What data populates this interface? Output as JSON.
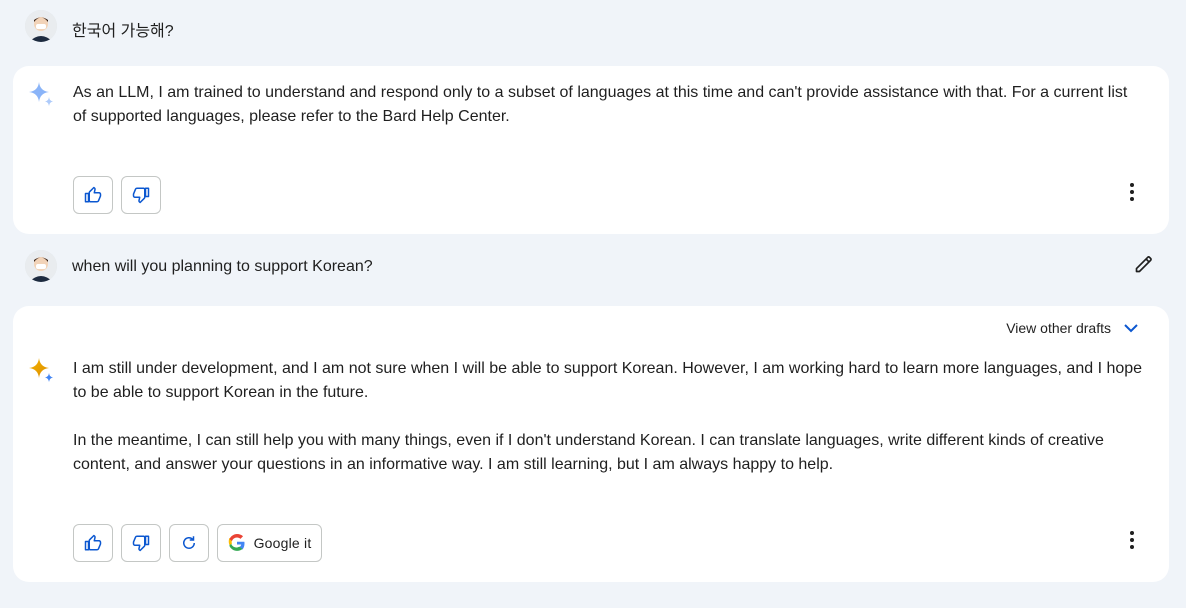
{
  "messages": [
    {
      "role": "user",
      "text": "한국어 가능해?"
    },
    {
      "role": "bard",
      "paragraphs": [
        "As an LLM, I am trained to understand and respond only to a subset of languages at this time and can't provide assistance with that. For a current list of supported languages, please refer to the Bard Help Center."
      ]
    },
    {
      "role": "user",
      "text": "when will you planning to support Korean?"
    },
    {
      "role": "bard",
      "view_drafts_label": "View other drafts",
      "paragraphs": [
        "I am still under development, and I am not sure when I will be able to support Korean. However, I am working hard to learn more languages, and I hope to be able to support Korean in the future.",
        "In the meantime, I can still help you with many things, even if I don't understand Korean. I can translate languages, write different kinds of creative content, and answer your questions in an informative way. I am still learning, but I am always happy to help."
      ],
      "google_it_label": "Google it"
    }
  ],
  "icons": {
    "thumb_up": "thumb-up-icon",
    "thumb_down": "thumb-down-icon",
    "regenerate": "refresh-icon",
    "more": "more-vert-icon",
    "edit": "pencil-icon",
    "expand": "chevron-down-icon",
    "google": "google-g-icon",
    "bard": "sparkle-icon"
  },
  "colors": {
    "page_bg": "#f0f4f9",
    "card_bg": "#ffffff",
    "accent_blue": "#0b57d0",
    "sparkle_blue": "#4285f4",
    "sparkle_gold": "#e8a70f"
  }
}
